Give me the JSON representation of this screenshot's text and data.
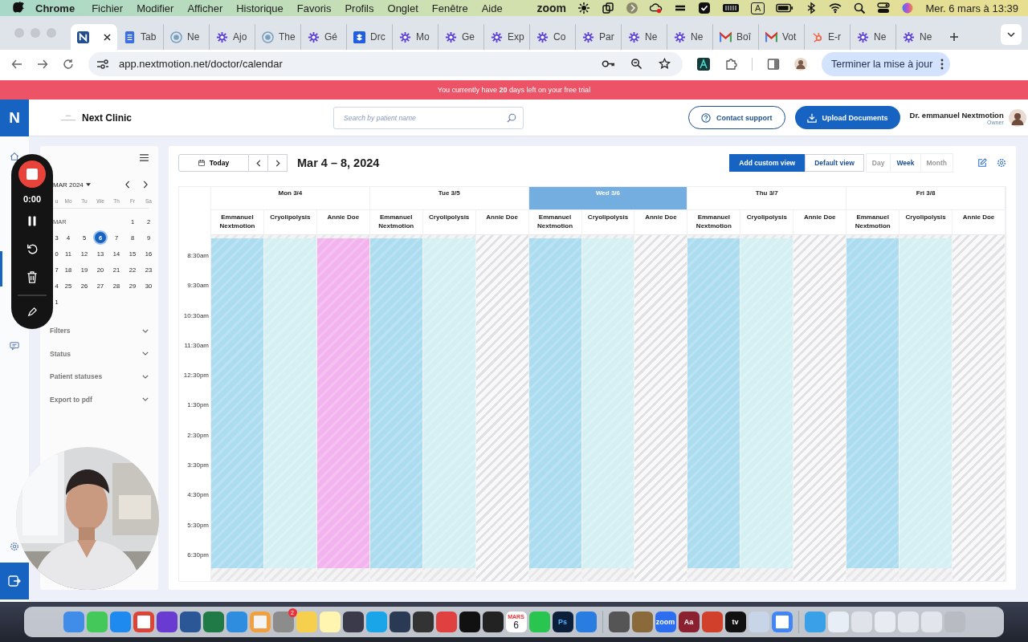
{
  "menubar": {
    "app": "Chrome",
    "items": [
      "Fichier",
      "Modifier",
      "Afficher",
      "Historique",
      "Favoris",
      "Profils",
      "Onglet",
      "Fenêtre",
      "Aide"
    ],
    "zoom": "zoom",
    "input_source": "A",
    "clock": "Mer. 6 mars à 13:39"
  },
  "browser": {
    "tabs": [
      {
        "kind": "app",
        "selected": true
      },
      {
        "title": "Tab",
        "kind": "doc",
        "selected": false
      },
      {
        "title": "Ne",
        "kind": "globe",
        "selected": false
      },
      {
        "title": "Ajo",
        "kind": "flower",
        "selected": false
      },
      {
        "title": "The",
        "kind": "globe",
        "selected": false
      },
      {
        "title": "Gé",
        "kind": "flower",
        "selected": false
      },
      {
        "title": "Drc",
        "kind": "box",
        "selected": false
      },
      {
        "title": "Mo",
        "kind": "flower",
        "selected": false
      },
      {
        "title": "Ge",
        "kind": "flower",
        "selected": false
      },
      {
        "title": "Exp",
        "kind": "flower",
        "selected": false
      },
      {
        "title": "Co",
        "kind": "flower",
        "selected": false
      },
      {
        "title": "Par",
        "kind": "flower",
        "selected": false
      },
      {
        "title": "Ne",
        "kind": "flower",
        "selected": false
      },
      {
        "title": "Ne",
        "kind": "flower",
        "selected": false
      },
      {
        "title": "Boî",
        "kind": "mail",
        "selected": false
      },
      {
        "title": "Vot",
        "kind": "mail",
        "selected": false
      },
      {
        "title": "E-r",
        "kind": "hub",
        "selected": false
      },
      {
        "title": "Ne",
        "kind": "flower",
        "selected": false
      },
      {
        "title": "Ne",
        "kind": "flower",
        "selected": false
      }
    ],
    "url": "app.nextmotion.net/doctor/calendar",
    "update_button": "Terminer la mise à jour"
  },
  "banner": "You currently have **20** days left on your free trial",
  "header": {
    "logo": "N",
    "clinic": "Next Clinic",
    "search": {
      "placeholder": "Search by patient name"
    },
    "contact_button": "Contact support",
    "upload_button": "Upload Documents",
    "user": "Dr. emmanuel Nextmotion",
    "role": "Owner"
  },
  "recorder": {
    "time": "0:00"
  },
  "mini_calendar": {
    "month": "MAR 2024",
    "weekdays": [
      "u",
      "Mo",
      "Tu",
      "We",
      "Th",
      "Fr",
      "Sa"
    ],
    "month_label": "MAR",
    "weeks": [
      [
        {
          "day": "1",
          "selected": false
        },
        {
          "day": "2",
          "selected": false
        }
      ],
      [
        {
          "day": "3",
          "selected": false
        },
        {
          "day": "4",
          "selected": false
        },
        {
          "day": "5",
          "selected": false
        },
        {
          "day": "6",
          "selected": true
        },
        {
          "day": "7",
          "selected": false
        },
        {
          "day": "8",
          "selected": false
        },
        {
          "day": "9",
          "selected": false
        }
      ],
      [
        {
          "day": "0",
          "selected": false
        },
        {
          "day": "11",
          "selected": false
        },
        {
          "day": "12",
          "selected": false
        },
        {
          "day": "13",
          "selected": false
        },
        {
          "day": "14",
          "selected": false
        },
        {
          "day": "15",
          "selected": false
        },
        {
          "day": "16",
          "selected": false
        }
      ],
      [
        {
          "day": "7",
          "selected": false
        },
        {
          "day": "18",
          "selected": false
        },
        {
          "day": "19",
          "selected": false
        },
        {
          "day": "20",
          "selected": false
        },
        {
          "day": "21",
          "selected": false
        },
        {
          "day": "22",
          "selected": false
        },
        {
          "day": "23",
          "selected": false
        }
      ],
      [
        {
          "day": "4",
          "selected": false
        },
        {
          "day": "25",
          "selected": false
        },
        {
          "day": "26",
          "selected": false
        },
        {
          "day": "27",
          "selected": false
        },
        {
          "day": "28",
          "selected": false
        },
        {
          "day": "29",
          "selected": false
        },
        {
          "day": "30",
          "selected": false
        }
      ],
      [
        {
          "day": "1",
          "selected": false
        }
      ]
    ]
  },
  "sections": [
    {
      "label": "Filters",
      "expanded": false
    },
    {
      "label": "Status",
      "expanded": false
    },
    {
      "label": "Patient statuses",
      "expanded": false
    },
    {
      "label": "Export to pdf",
      "expanded": false
    }
  ],
  "toolbar": {
    "today": "Today",
    "title": "Mar 4 – 8, 2024",
    "views": [
      {
        "label": "Add custom view",
        "kind": "primary"
      },
      {
        "label": "Default view",
        "kind": "outline"
      }
    ],
    "ranges": [
      {
        "label": "Day",
        "selected": false
      },
      {
        "label": "Week",
        "selected": true
      },
      {
        "label": "Month",
        "selected": false
      }
    ]
  },
  "days": [
    {
      "label": "Mon 3/4",
      "selected": false,
      "resources": [
        {
          "name": "Emmanuel Nextmotion",
          "kind": "open",
          "color": "#acdcef"
        },
        {
          "name": "Cryolipolysis",
          "kind": "open",
          "color": "#d5f0f3"
        },
        {
          "name": "Annie Doe",
          "kind": "open",
          "color": "#f2b3ee"
        }
      ]
    },
    {
      "label": "Tue 3/5",
      "selected": false,
      "resources": [
        {
          "name": "Emmanuel Nextmotion",
          "kind": "open",
          "color": "#acdcef"
        },
        {
          "name": "Cryolipolysis",
          "kind": "open",
          "color": "#d5f0f3"
        },
        {
          "name": "Annie Doe",
          "kind": "closed"
        }
      ]
    },
    {
      "label": "Wed 3/6",
      "selected": true,
      "resources": [
        {
          "name": "Emmanuel Nextmotion",
          "kind": "open",
          "color": "#acdcef"
        },
        {
          "name": "Cryolipolysis",
          "kind": "open",
          "color": "#d5f0f3"
        },
        {
          "name": "Annie Doe",
          "kind": "closed"
        }
      ]
    },
    {
      "label": "Thu 3/7",
      "selected": false,
      "resources": [
        {
          "name": "Emmanuel Nextmotion",
          "kind": "open",
          "color": "#acdcef"
        },
        {
          "name": "Cryolipolysis",
          "kind": "open",
          "color": "#d5f0f3"
        },
        {
          "name": "Annie Doe",
          "kind": "closed"
        }
      ]
    },
    {
      "label": "Fri 3/8",
      "selected": false,
      "resources": [
        {
          "name": "Emmanuel Nextmotion",
          "kind": "open",
          "color": "#acdcef"
        },
        {
          "name": "Cryolipolysis",
          "kind": "open",
          "color": "#d5f0f3"
        },
        {
          "name": "Annie Doe",
          "kind": "closed"
        }
      ]
    }
  ],
  "times": [
    "8:30am",
    "9:30am",
    "10:30am",
    "11:30am",
    "12:30pm",
    "1:30pm",
    "2:30pm",
    "3:30pm",
    "4:30pm",
    "5:30pm",
    "6:30pm"
  ],
  "dock": {
    "labels": [
      "2",
      "MARS",
      "6",
      "Ps",
      "zoom",
      "Aa",
      "tv"
    ]
  }
}
